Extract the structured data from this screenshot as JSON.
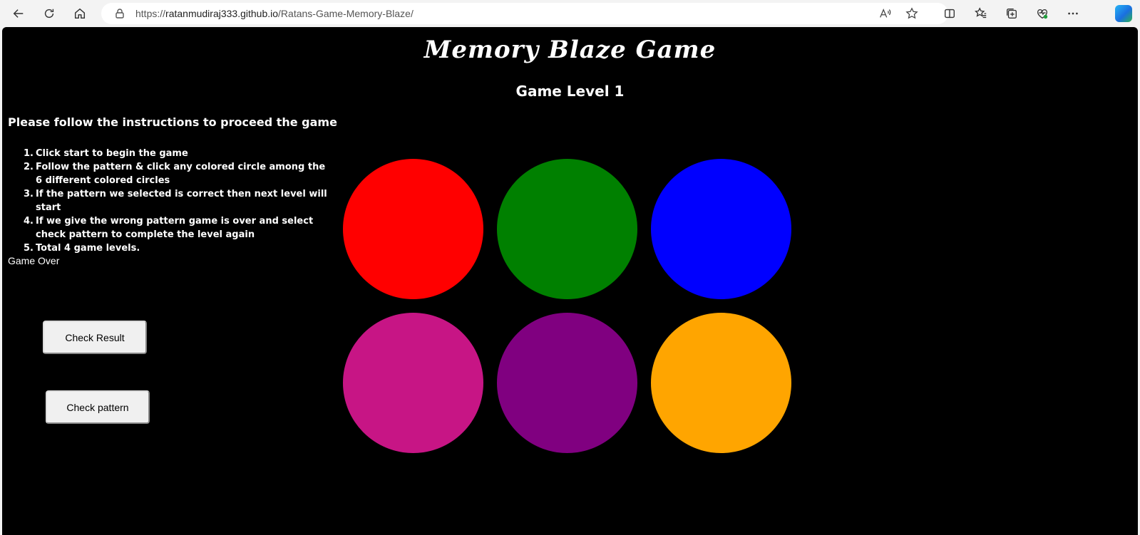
{
  "browser": {
    "url_prefix": "https://",
    "url_host": "ratanmudiraj333.github.io",
    "url_path": "/Ratans-Game-Memory-Blaze/"
  },
  "game": {
    "title": "Memory Blaze Game",
    "level": "Game Level 1",
    "instructions_heading": "Please follow the instructions to proceed the game",
    "steps": [
      {
        "num": "1.",
        "text": "Click start to begin the game"
      },
      {
        "num": "2.",
        "text": "Follow the pattern & click any colored circle among the 6 different colored circles"
      },
      {
        "num": "3.",
        "text": "If the pattern we selected is correct then next level will start"
      },
      {
        "num": "4.",
        "text": "If we give the wrong pattern game is over and select check pattern to complete the level again"
      },
      {
        "num": "5.",
        "text": "Total 4 game levels."
      }
    ],
    "status": "Game Over",
    "check_result_label": "Check Result",
    "check_pattern_label": "Check pattern",
    "circle_colors": [
      "#ff0000",
      "#008000",
      "#0000ff",
      "#c71585",
      "#800080",
      "#ffa500"
    ]
  }
}
